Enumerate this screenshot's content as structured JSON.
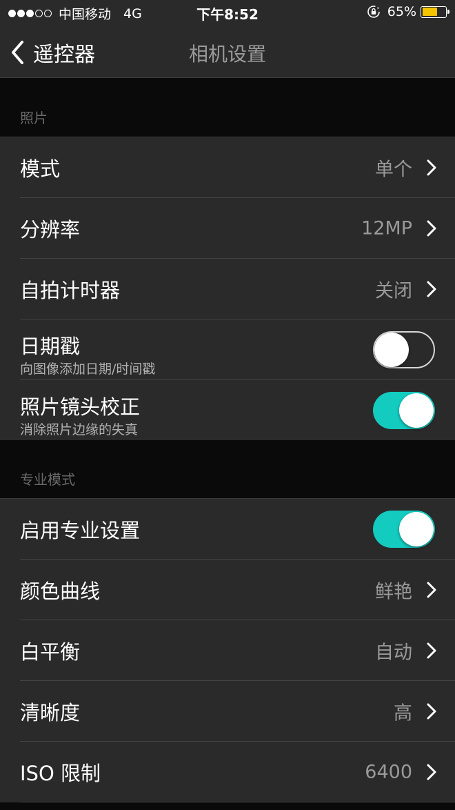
{
  "status_bar": {
    "signal": {
      "filled": 3,
      "total": 5
    },
    "carrier": "中国移动",
    "network": "4G",
    "time": "下午8:52",
    "battery_percent": "65%",
    "battery_level": 0.65,
    "battery_color": "#f5c400",
    "lock_icon": "rotation-lock-icon"
  },
  "nav": {
    "back_label": "遥控器",
    "title": "相机设置",
    "back_icon": "chevron-left-icon"
  },
  "sections": {
    "photo": {
      "header": "照片",
      "rows": {
        "mode": {
          "label": "模式",
          "value": "单个"
        },
        "resolution": {
          "label": "分辨率",
          "value": "12MP"
        },
        "self_timer": {
          "label": "自拍计时器",
          "value": "关闭"
        },
        "date_stamp": {
          "label": "日期戳",
          "sublabel": "向图像添加日期/时间戳",
          "toggle": false
        },
        "lens_correction": {
          "label": "照片镜头校正",
          "sublabel": "消除照片边缘的失真",
          "toggle": true
        }
      }
    },
    "pro": {
      "header": "专业模式",
      "rows": {
        "enable_pro": {
          "label": "启用专业设置",
          "toggle": true
        },
        "color_curve": {
          "label": "颜色曲线",
          "value": "鲜艳"
        },
        "white_balance": {
          "label": "白平衡",
          "value": "自动"
        },
        "sharpness": {
          "label": "清晰度",
          "value": "高"
        },
        "iso_limit": {
          "label": "ISO 限制",
          "value": "6400"
        }
      }
    }
  },
  "colors": {
    "accent_toggle_on": "#14cbc0",
    "background": "#0a0a0a",
    "row_background": "#2a2a2a"
  }
}
